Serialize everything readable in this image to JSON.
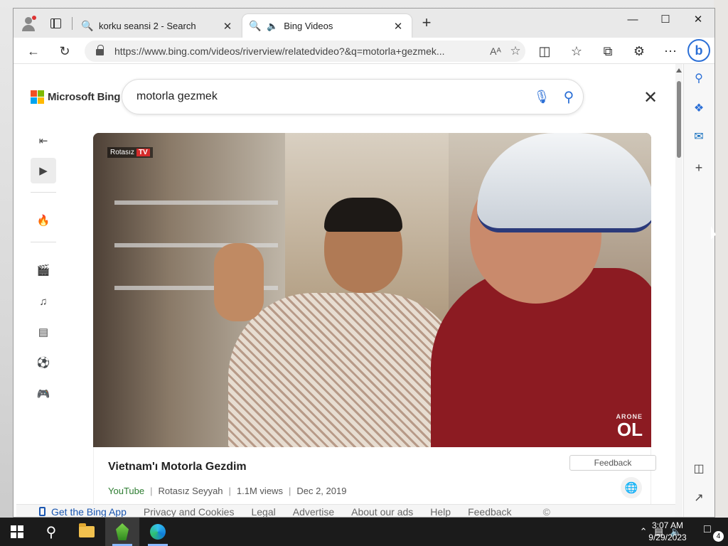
{
  "browser": {
    "tabs": [
      {
        "title": "korku seansi 2 - Search",
        "icon": "search-icon",
        "close": "✕"
      },
      {
        "title": "Bing Videos",
        "icon": "search-icon",
        "close": "✕"
      }
    ],
    "new_tab": "+",
    "window_controls": {
      "minimize": "—",
      "maximize": "☐",
      "close": "✕"
    },
    "address": "https://www.bing.com/videos/riverview/relatedvideo?&q=motorla+gezmek...",
    "read_aloud": "Aᴬ"
  },
  "page": {
    "brand": "Microsoft Bing",
    "ms_colors": [
      "#f25022",
      "#7fba00",
      "#00a4ef",
      "#ffb900"
    ],
    "search": {
      "query": "motorla gezmek"
    },
    "close": "✕",
    "video": {
      "channel_badge": "Rotasız",
      "channel_badge_tv": "TV",
      "watermark_top": "ARONE",
      "watermark_big": "OL"
    },
    "result": {
      "title": "Vietnam'ı Motorla Gezdim",
      "source": "YouTube",
      "channel": "Rotasız Seyyah",
      "views": "1.1M views",
      "date": "Dec 2, 2019"
    },
    "footer": {
      "get_app": "Get the Bing App",
      "links": [
        "Privacy and Cookies",
        "Legal",
        "Advertise",
        "About our ads",
        "Help",
        "Feedback"
      ],
      "copyright": "©",
      "feedback_button": "Feedback"
    }
  },
  "taskbar": {
    "time": "3:07 AM",
    "date": "9/29/2023",
    "notification_count": "4"
  }
}
